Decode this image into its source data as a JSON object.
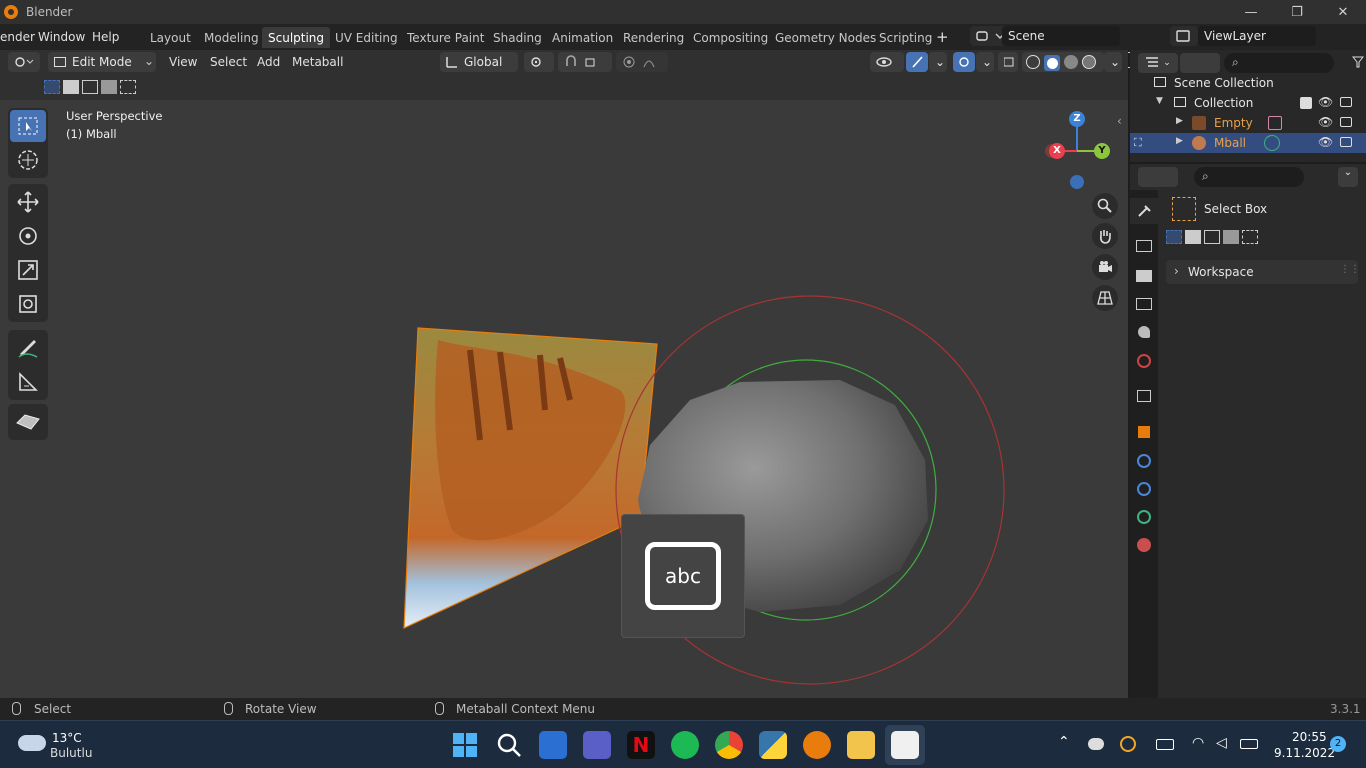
{
  "window": {
    "title": "Blender",
    "min": "—",
    "max": "❐",
    "close": "✕"
  },
  "menus": [
    "ender",
    "Window",
    "Help"
  ],
  "workspaces": [
    {
      "label": "Layout"
    },
    {
      "label": "Modeling"
    },
    {
      "label": "Sculpting",
      "active": true
    },
    {
      "label": "UV Editing"
    },
    {
      "label": "Texture Paint"
    },
    {
      "label": "Shading"
    },
    {
      "label": "Animation"
    },
    {
      "label": "Rendering"
    },
    {
      "label": "Compositing"
    },
    {
      "label": "Geometry Nodes"
    },
    {
      "label": "Scripting"
    }
  ],
  "add_workspace": "+",
  "scene": {
    "label": "Scene"
  },
  "view_layer": {
    "label": "ViewLayer"
  },
  "viewport_header": {
    "mode": "Edit Mode",
    "menus": [
      "View",
      "Select",
      "Add",
      "Metaball"
    ],
    "orientation": "Global"
  },
  "viewport": {
    "perspective": "User Perspective",
    "object": "(1) Mball"
  },
  "gizmo": {
    "x": "X",
    "y": "Y",
    "z": "Z"
  },
  "keyboard_overlay": "abc",
  "outliner": {
    "root": "Scene Collection",
    "collection": "Collection",
    "items": [
      {
        "label": "Empty"
      },
      {
        "label": "Mball"
      }
    ]
  },
  "properties": {
    "tool": "Select Box",
    "panel": "Workspace"
  },
  "status": {
    "left": "Select",
    "mid": "Rotate View",
    "right": "Metaball Context Menu",
    "version": "3.3.1"
  },
  "taskbar": {
    "weather_temp": "13°C",
    "weather_desc": "Bulutlu",
    "time": "20:55",
    "date": "9.11.2022",
    "notifications": "2"
  },
  "colors": {
    "accent": "#4772b3",
    "selected_row": "#334d80",
    "object_orange": "#e8a04a",
    "x_axis": "#e8404e",
    "y_axis": "#8cc63e",
    "z_axis": "#3b83d8"
  }
}
